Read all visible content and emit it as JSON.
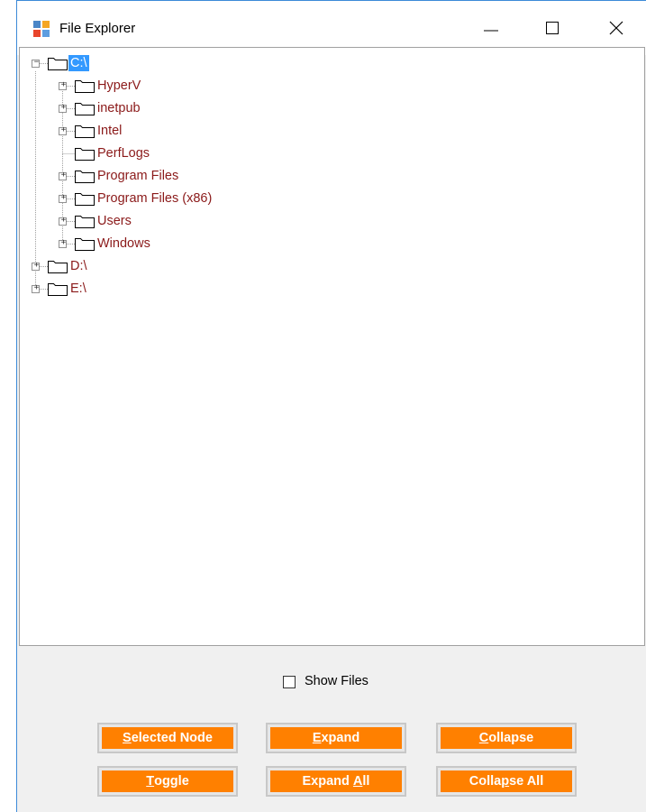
{
  "window": {
    "title": "File Explorer",
    "icon": "app-window-icon",
    "controls": [
      "minimize-icon",
      "maximize-icon",
      "close-icon"
    ]
  },
  "tree": {
    "nodes": [
      {
        "label": "C:\\",
        "expanded": true,
        "selected": true
      },
      {
        "label": "HyperV",
        "expandable": true
      },
      {
        "label": "inetpub",
        "expandable": true
      },
      {
        "label": "Intel",
        "expandable": true
      },
      {
        "label": "PerfLogs",
        "expandable": false
      },
      {
        "label": "Program Files",
        "expandable": true
      },
      {
        "label": "Program Files (x86)",
        "expandable": true
      },
      {
        "label": "Users",
        "expandable": true
      },
      {
        "label": "Windows",
        "expandable": true
      },
      {
        "label": "D:\\",
        "expandable": true
      },
      {
        "label": "E:\\",
        "expandable": true
      }
    ]
  },
  "show_files": {
    "label": "Show Files",
    "checked": false
  },
  "buttons": {
    "selected_node": {
      "mnemonic": "S",
      "rest": "elected Node"
    },
    "expand": {
      "mnemonic": "E",
      "rest": "xpand"
    },
    "collapse": {
      "mnemonic": "C",
      "rest": "ollapse"
    },
    "toggle": {
      "mnemonic": "T",
      "rest": "oggle"
    },
    "expand_all": {
      "pre": "Expand ",
      "mnemonic": "A",
      "rest": "ll"
    },
    "collapse_all": {
      "pre": "Colla",
      "mnemonic": "p",
      "rest": "se All"
    }
  },
  "colors": {
    "button_face": "#ff8000",
    "node_text": "#8b1a1a",
    "selection": "#3399ff",
    "window_border": "#3c8ad8"
  }
}
